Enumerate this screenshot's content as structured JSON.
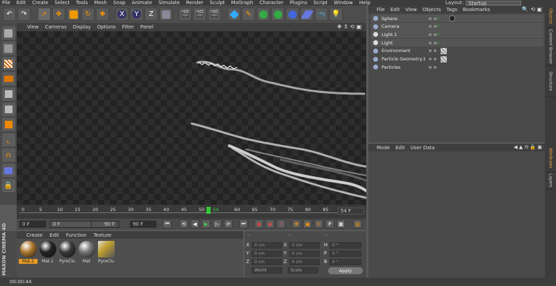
{
  "menu": [
    "File",
    "Edit",
    "Create",
    "Select",
    "Tools",
    "Mesh",
    "Snap",
    "Animate",
    "Simulate",
    "Render",
    "Sculpt",
    "MoGraph",
    "Character",
    "Plugins",
    "Script",
    "Window",
    "Help"
  ],
  "layout": {
    "label": "Layout:",
    "value": "Startup"
  },
  "viewport": {
    "menu": [
      "View",
      "Cameras",
      "Display",
      "Options",
      "Filter",
      "Panel"
    ]
  },
  "timeline": {
    "ticks": [
      "0",
      "5",
      "10",
      "15",
      "20",
      "25",
      "30",
      "35",
      "40",
      "45",
      "50",
      "54",
      "60",
      "65",
      "70",
      "75",
      "80",
      "85",
      "90"
    ],
    "current_frame_field": "54 F"
  },
  "transport": {
    "start": "0 F",
    "min": "0 F",
    "max": "90 F",
    "end": "90 F"
  },
  "materials": {
    "menu": [
      "Create",
      "Edit",
      "Function",
      "Texture"
    ],
    "items": [
      {
        "label": "Mat.2",
        "color": "#b07a30"
      },
      {
        "label": "Mat.1",
        "color": "#222222"
      },
      {
        "label": "PyroClu",
        "color": "#3a3a3a"
      },
      {
        "label": "Mat",
        "color": "#777777"
      },
      {
        "label": "PyroClu",
        "color": "#c0a030"
      }
    ]
  },
  "coords": {
    "labels": [
      "X",
      "Y",
      "Z"
    ],
    "pos": [
      "0 cm",
      "0 cm",
      "0 cm"
    ],
    "size": [
      "0 cm",
      "0 cm",
      "0 cm"
    ],
    "rot_labels": [
      "H",
      "P",
      "B"
    ],
    "rot": [
      "0 °",
      "0 °",
      "0 °"
    ],
    "world": "World",
    "scale": "Scale",
    "apply": "Apply"
  },
  "objects": {
    "menu": [
      "File",
      "Edit",
      "View",
      "Objects",
      "Tags",
      "Bookmarks"
    ],
    "rows": [
      "Sphere",
      "Camera",
      "Light.1",
      "Light",
      "Environment",
      "Particle Geometry.1",
      "Particles"
    ]
  },
  "attributes": {
    "menu": [
      "Mode",
      "Edit",
      "User Data"
    ]
  },
  "right_tabs": [
    "Objects",
    "Content Browser",
    "Structure",
    "Attributes",
    "Layers"
  ],
  "branding": "MAXON CINEMA 4D",
  "status": "00:00:44"
}
